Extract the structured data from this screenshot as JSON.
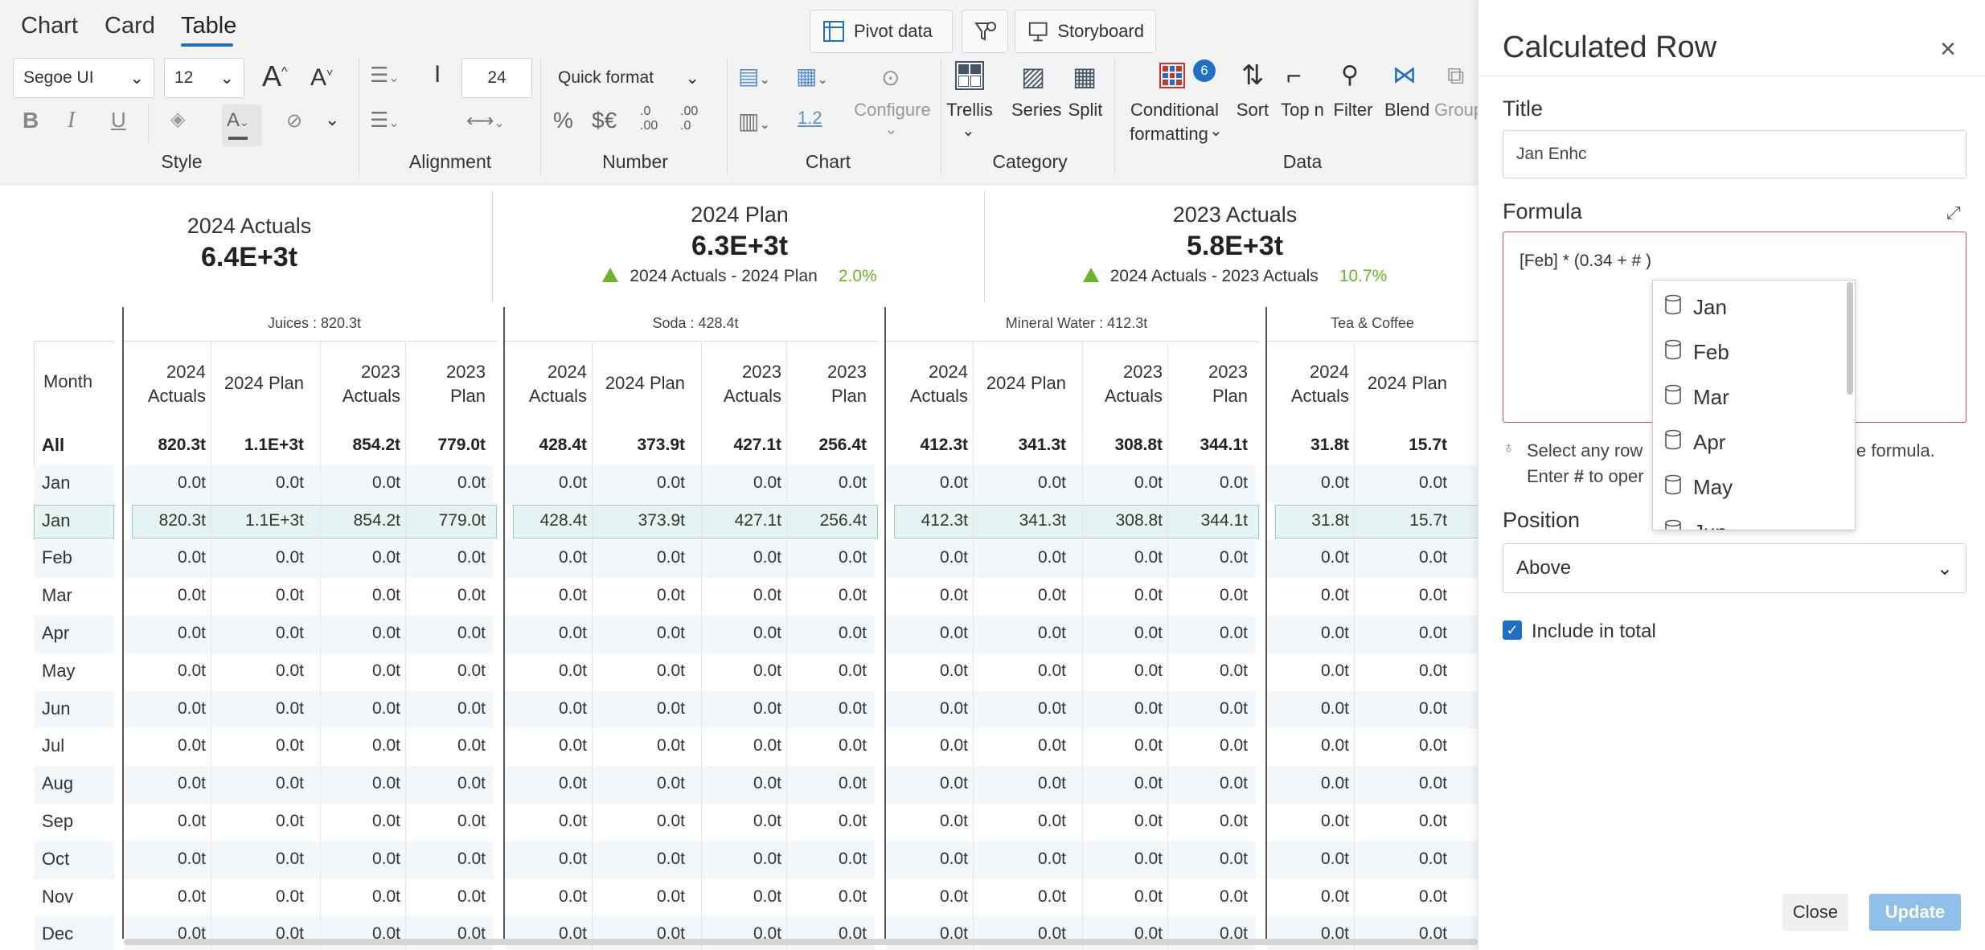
{
  "view_tabs": [
    "Chart",
    "Card",
    "Table"
  ],
  "toolbar": {
    "pivot_label": "Pivot data",
    "storyboard_label": "Storyboard",
    "font_family": "Segoe UI",
    "font_size": "12",
    "line_height": "24",
    "quick_format": "Quick format",
    "bold": "B",
    "italic": "I",
    "underline": "U",
    "percent": "%",
    "currency": "$€",
    "dec_inc": ".0 .00",
    "dec_dec": ".00 .0",
    "num_sample": "1.2",
    "configure": "Configure",
    "trellis": "Trellis",
    "series": "Series",
    "split": "Split",
    "conditional": "Conditional",
    "formatting": "formatting",
    "badge": "6",
    "sort": "Sort",
    "topn": "Top n",
    "filter": "Filter",
    "blend": "Blend",
    "group": "Group",
    "groups": [
      "Style",
      "Alignment",
      "Number",
      "Chart",
      "Category",
      "Data"
    ]
  },
  "kpis": [
    {
      "title": "2024 Actuals",
      "value": "6.4E+3t"
    },
    {
      "title": "2024 Plan",
      "value": "6.3E+3t",
      "delta_label": "2024 Actuals - 2024 Plan",
      "delta_pct": "2.0%"
    },
    {
      "title": "2023 Actuals",
      "value": "5.8E+3t",
      "delta_label": "2024 Actuals - 2023 Actuals",
      "delta_pct": "10.7%"
    }
  ],
  "colors": {
    "accent": "#1f6fc5",
    "positive": "#6bb32a",
    "highlight_row": "#e6f3f3",
    "highlight_border": "#8fcfcf",
    "error_border": "#e05050",
    "update_btn": "#8ec0ea"
  },
  "table": {
    "month_header": "Month",
    "group_titles": [
      "Juices : 820.3t",
      "Soda : 428.4t",
      "Mineral Water : 412.3t",
      "Tea & Coffee"
    ],
    "col_headers": [
      [
        "2024",
        "Actuals"
      ],
      [
        "",
        "2024 Plan"
      ],
      [
        "2023",
        "Actuals"
      ],
      [
        "2023",
        "Plan"
      ]
    ],
    "months": [
      "All",
      "Jan",
      "Jan",
      "Feb",
      "Mar",
      "Apr",
      "May",
      "Jun",
      "Jul",
      "Aug",
      "Sep",
      "Oct",
      "Nov",
      "Dec"
    ],
    "all_row": [
      [
        "820.3t",
        "1.1E+3t",
        "854.2t",
        "779.0t"
      ],
      [
        "428.4t",
        "373.9t",
        "427.1t",
        "256.4t"
      ],
      [
        "412.3t",
        "341.3t",
        "308.8t",
        "344.1t"
      ],
      [
        "31.8t",
        "15.7t"
      ]
    ],
    "calc_row": [
      [
        "820.3t",
        "1.1E+3t",
        "854.2t",
        "779.0t"
      ],
      [
        "428.4t",
        "373.9t",
        "427.1t",
        "256.4t"
      ],
      [
        "412.3t",
        "341.3t",
        "308.8t",
        "344.1t"
      ],
      [
        "31.8t",
        "15.7t"
      ]
    ],
    "zero": "0.0t"
  },
  "panel": {
    "title": "Calculated Row",
    "title_label": "Title",
    "title_value": "Jan Enhc",
    "formula_label": "Formula",
    "formula_value": "[Feb] * (0.34 + # )",
    "hint_a": "Select any row",
    "hint_b": "e formula.",
    "hint_c1": "Enter ",
    "hint_hash": "#",
    "hint_c2": " to oper",
    "position_label": "Position",
    "position_value": "Above",
    "include_label": "Include in total",
    "close_label": "Close",
    "update_label": "Update",
    "dropdown_items": [
      "Jan",
      "Feb",
      "Mar",
      "Apr",
      "May",
      "Jun"
    ]
  }
}
